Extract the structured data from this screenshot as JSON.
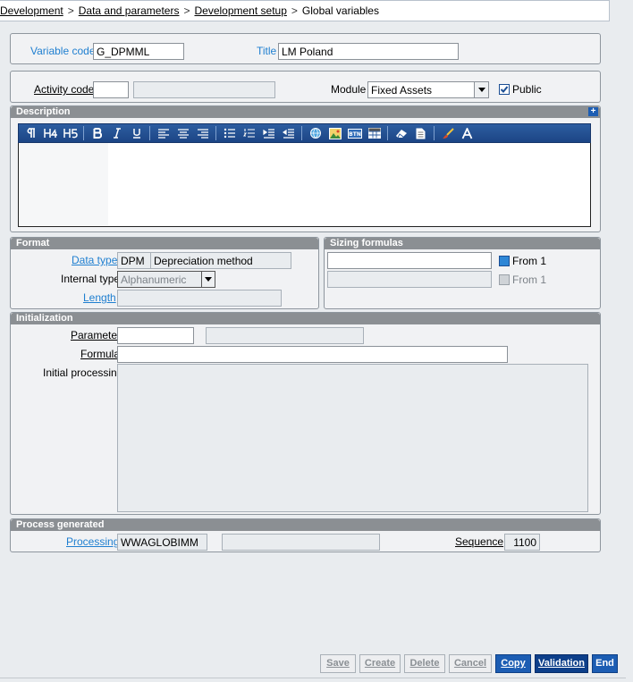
{
  "breadcrumb": {
    "items": [
      "Development",
      "Data and parameters",
      "Development setup"
    ],
    "current": "Global variables",
    "separator": ">"
  },
  "header": {
    "variable_code_label": "Variable code",
    "variable_code_value": "G_DPMML",
    "title_label": "Title",
    "title_value": "LM Poland"
  },
  "activity": {
    "activity_code_label": "Activity code",
    "activity_code_value": "",
    "activity_desc_value": "",
    "module_label": "Module",
    "module_value": "Fixed Assets",
    "public_label": "Public",
    "public_checked": true
  },
  "description": {
    "title": "Description",
    "toolbar": [
      "P",
      "H4",
      "H5",
      "B",
      "I",
      "U",
      "align-left",
      "align-center",
      "align-right",
      "bullet-list",
      "numbered-list",
      "indent",
      "outdent",
      "globe",
      "image",
      "button",
      "table",
      "eraser",
      "document",
      "brush",
      "font-color"
    ],
    "content": ""
  },
  "format": {
    "title": "Format",
    "data_type_label": "Data type",
    "data_type_code": "DPM",
    "data_type_desc": "Depreciation method",
    "internal_type_label": "Internal type",
    "internal_type_value": "Alphanumeric",
    "length_label": "Length",
    "length_value": ""
  },
  "sizing": {
    "title": "Sizing formulas",
    "row1_value": "",
    "row1_from": "From 1",
    "row2_value": "",
    "row2_from": "From 1"
  },
  "initialization": {
    "title": "Initialization",
    "parameter_label": "Parameter",
    "parameter_value": "",
    "parameter_desc": "",
    "formula_label": "Formula",
    "formula_value": "",
    "initial_processing_label": "Initial processing",
    "initial_processing_value": ""
  },
  "process_generated": {
    "title": "Process generated",
    "processing_label": "Processing",
    "processing_value": "WWAGLOBIMM",
    "processing_desc": "",
    "sequence_label": "Sequence",
    "sequence_value": "1100"
  },
  "buttons": {
    "save": "Save",
    "create": "Create",
    "delete": "Delete",
    "cancel": "Cancel",
    "copy": "Copy",
    "validation": "Validation",
    "end": "End"
  },
  "colors": {
    "accent": "#1c5db3",
    "section_header": "#8b8f93",
    "link": "#1f7fd0"
  }
}
